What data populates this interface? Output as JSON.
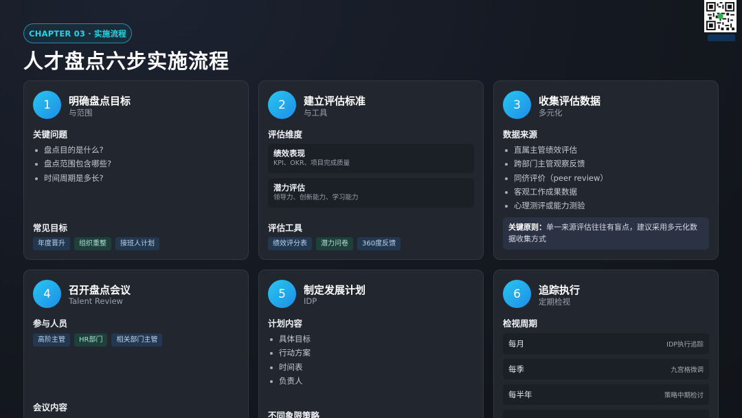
{
  "chapter": "CHAPTER 03 · 实施流程",
  "title": "人才盘点六步实施流程",
  "colors": {
    "accent": "#25d3e4",
    "card_bg": "#22262e",
    "step_gradient_start": "#28c6f0",
    "step_gradient_end": "#1e8ee8"
  },
  "steps": [
    {
      "num": "1",
      "title": "明确盘点目标",
      "subtitle": "与范围",
      "sections": [
        {
          "heading": "关键问题",
          "bullets": [
            "盘点目的是什么?",
            "盘点范围包含哪些?",
            "时间周期是多长?"
          ]
        },
        {
          "heading": "常见目标",
          "tags": [
            "年度晋升",
            "组织重整",
            "接班人计划"
          ]
        }
      ]
    },
    {
      "num": "2",
      "title": "建立评估标准",
      "subtitle": "与工具",
      "sections": [
        {
          "heading": "评估维度",
          "dimensions": [
            {
              "name": "绩效表现",
              "desc": "KPI、OKR、项目完成质量"
            },
            {
              "name": "潜力评估",
              "desc": "领导力、创新能力、学习能力"
            }
          ]
        },
        {
          "heading": "评估工具",
          "tags": [
            "绩效评分表",
            "潜力问卷",
            "360度反馈"
          ]
        }
      ]
    },
    {
      "num": "3",
      "title": "收集评估数据",
      "subtitle": "多元化",
      "sections": [
        {
          "heading": "数据来源",
          "bullets": [
            "直属主管绩效评估",
            "跨部门主管观察反馈",
            "同侪评价（peer review）",
            "客观工作成果数据",
            "心理测评或能力测验"
          ]
        }
      ],
      "note": {
        "label": "关键原则：",
        "text": "单一来源评估往往有盲点，建议采用多元化数据收集方式"
      }
    },
    {
      "num": "4",
      "title": "召开盘点会议",
      "subtitle": "Talent Review",
      "sections": [
        {
          "heading": "参与人员",
          "tags": [
            "高阶主管",
            "HR部门",
            "相关部门主管"
          ]
        },
        {
          "heading": "会议内容"
        }
      ]
    },
    {
      "num": "5",
      "title": "制定发展计划",
      "subtitle": "IDP",
      "sections": [
        {
          "heading": "计划内容",
          "bullets": [
            "具体目标",
            "行动方案",
            "时间表",
            "负责人"
          ]
        },
        {
          "heading": "不同象限策略"
        }
      ]
    },
    {
      "num": "6",
      "title": "追踪执行",
      "subtitle": "定期检视",
      "sections": [
        {
          "heading": "检视周期",
          "rows": [
            {
              "k": "每月",
              "v": "IDP执行追踪"
            },
            {
              "k": "每季",
              "v": "九宫格微调"
            },
            {
              "k": "每半年",
              "v": "策略中期检讨"
            }
          ]
        }
      ]
    }
  ]
}
